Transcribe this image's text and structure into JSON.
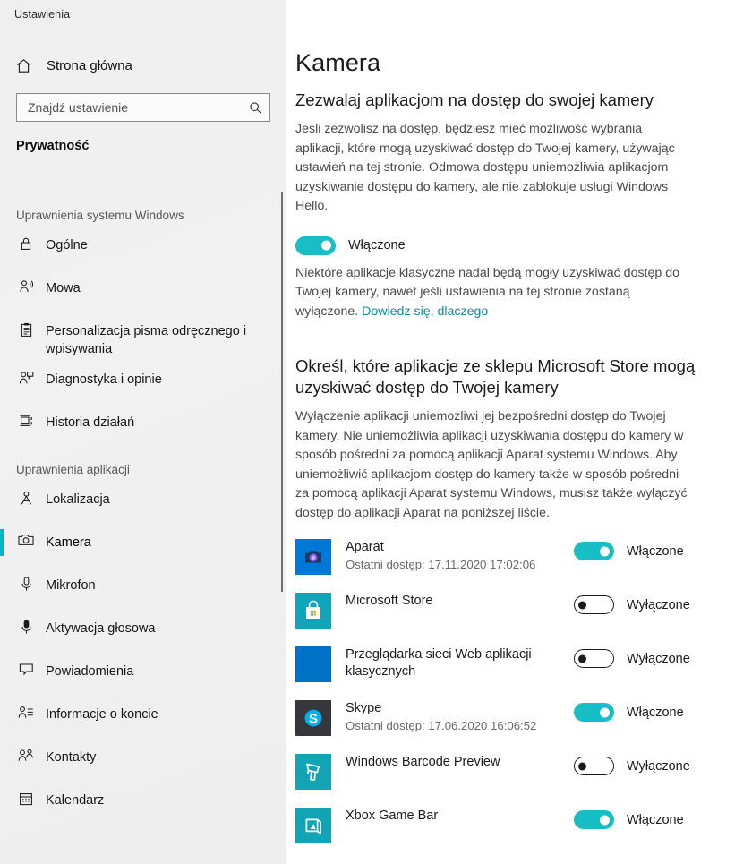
{
  "sidebar": {
    "app_title": "Ustawienia",
    "home": {
      "label": "Strona główna",
      "icon": "home-icon"
    },
    "search": {
      "placeholder": "Znajdź ustawienie",
      "value": "",
      "icon": "search-icon"
    },
    "category": "Prywatność",
    "groups": [
      {
        "heading": "Uprawnienia systemu Windows",
        "items": [
          {
            "label": "Ogólne",
            "icon": "lock-icon",
            "selected": false
          },
          {
            "label": "Mowa",
            "icon": "speech-icon",
            "selected": false
          },
          {
            "label": "Personalizacja pisma odręcznego i wpisywania",
            "icon": "clipboard-icon",
            "selected": false
          },
          {
            "label": "Diagnostyka i opinie",
            "icon": "feedback-icon",
            "selected": false
          },
          {
            "label": "Historia działań",
            "icon": "activity-history-icon",
            "selected": false
          }
        ]
      },
      {
        "heading": "Uprawnienia aplikacji",
        "items": [
          {
            "label": "Lokalizacja",
            "icon": "location-icon",
            "selected": false
          },
          {
            "label": "Kamera",
            "icon": "camera-icon",
            "selected": true
          },
          {
            "label": "Mikrofon",
            "icon": "microphone-icon",
            "selected": false
          },
          {
            "label": "Aktywacja głosowa",
            "icon": "voice-activation-icon",
            "selected": false
          },
          {
            "label": "Powiadomienia",
            "icon": "notification-icon",
            "selected": false
          },
          {
            "label": "Informacje o koncie",
            "icon": "account-info-icon",
            "selected": false
          },
          {
            "label": "Kontakty",
            "icon": "contacts-icon",
            "selected": false
          },
          {
            "label": "Kalendarz",
            "icon": "calendar-icon",
            "selected": false
          }
        ]
      }
    ]
  },
  "main": {
    "page_title": "Kamera",
    "section1": {
      "heading": "Zezwalaj aplikacjom na dostęp do swojej kamery",
      "description": "Jeśli zezwolisz na dostęp, będziesz mieć możliwość wybrania aplikacji, które mogą uzyskiwać dostęp do Twojej kamery, używając ustawień na tej stronie. Odmowa dostępu uniemożliwia aplikacjom uzyskiwanie dostępu do kamery, ale nie zablokuje usługi Windows Hello.",
      "toggle_state": "on",
      "toggle_label": "Włączone",
      "note_text": "Niektóre aplikacje klasyczne nadal będą mogły uzyskiwać dostęp do Twojej kamery, nawet jeśli ustawienia na tej stronie zostaną wyłączone. ",
      "note_link": "Dowiedz się, dlaczego"
    },
    "section2": {
      "heading": "Określ, które aplikacje ze sklepu Microsoft Store mogą uzyskiwać dostęp do Twojej kamery",
      "description": "Wyłączenie aplikacji uniemożliwi jej bezpośredni dostęp do Twojej kamery. Nie uniemożliwia aplikacji uzyskiwania dostępu do kamery w sposób pośredni za pomocą aplikacji Aparat systemu Windows. Aby uniemożliwić aplikacjom dostęp do kamery także w sposób pośredni za pomocą aplikacji Aparat systemu Windows, musisz także wyłączyć dostęp do aplikacji Aparat na poniższej liście.",
      "apps": [
        {
          "name": "Aparat",
          "sub": "Ostatni dostęp: 17.11.2020 17:02:06",
          "icon": "camera-app-icon",
          "state": "on",
          "state_label": "Włączone"
        },
        {
          "name": "Microsoft Store",
          "sub": "",
          "icon": "microsoft-store-icon",
          "state": "off",
          "state_label": "Wyłączone"
        },
        {
          "name": "Przeglądarka sieci Web aplikacji klasycznych",
          "sub": "",
          "icon": "desktop-web-viewer-icon",
          "state": "off",
          "state_label": "Wyłączone"
        },
        {
          "name": "Skype",
          "sub": "Ostatni dostęp: 17.06.2020 16:06:52",
          "icon": "skype-icon",
          "state": "on",
          "state_label": "Włączone"
        },
        {
          "name": "Windows Barcode Preview",
          "sub": "",
          "icon": "barcode-scanner-icon",
          "state": "off",
          "state_label": "Wyłączone"
        },
        {
          "name": "Xbox Game Bar",
          "sub": "",
          "icon": "xbox-game-bar-icon",
          "state": "on",
          "state_label": "Włączone"
        }
      ]
    }
  },
  "colors": {
    "accent": "#00b7c3",
    "toggle_on": "#17bec6",
    "link": "#0b8f9b",
    "sidebar_bg": "#efefef",
    "aparat_tile": "#0078d7",
    "store_tile": "#10a5b8",
    "webviewer_tile": "#0072c6",
    "skype_tile": "#36373b",
    "barcode_tile": "#12a3b4",
    "xbox_tile": "#12a3b4"
  }
}
